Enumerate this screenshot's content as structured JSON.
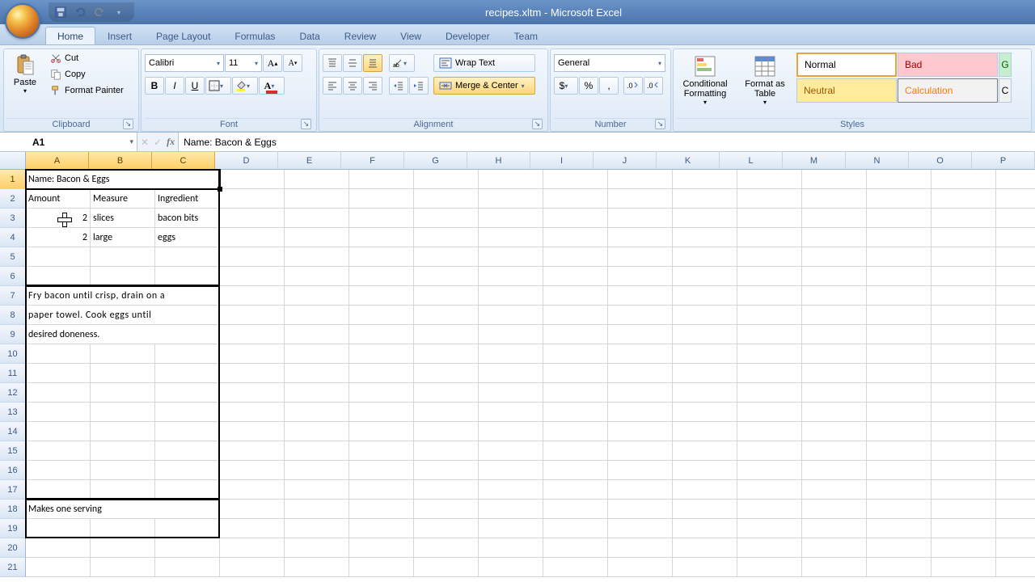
{
  "app": {
    "title": "recipes.xltm - Microsoft Excel"
  },
  "tabs": [
    "Home",
    "Insert",
    "Page Layout",
    "Formulas",
    "Data",
    "Review",
    "View",
    "Developer",
    "Team"
  ],
  "active_tab": "Home",
  "ribbon": {
    "clipboard": {
      "label": "Clipboard",
      "paste": "Paste",
      "cut": "Cut",
      "copy": "Copy",
      "format_painter": "Format Painter"
    },
    "font": {
      "label": "Font",
      "name": "Calibri",
      "size": "11"
    },
    "alignment": {
      "label": "Alignment",
      "wrap": "Wrap Text",
      "merge": "Merge & Center"
    },
    "number": {
      "label": "Number",
      "format": "General"
    },
    "styles": {
      "label": "Styles",
      "conditional": "Conditional Formatting",
      "format_table": "Format as Table",
      "cells": [
        "Normal",
        "Bad",
        "Neutral",
        "Calculation"
      ]
    }
  },
  "name_box": "A1",
  "formula": "Name: Bacon & Eggs",
  "columns": [
    {
      "l": "A",
      "w": 80
    },
    {
      "l": "B",
      "w": 80
    },
    {
      "l": "C",
      "w": 80
    },
    {
      "l": "D",
      "w": 80
    },
    {
      "l": "E",
      "w": 80
    },
    {
      "l": "F",
      "w": 80
    },
    {
      "l": "G",
      "w": 80
    },
    {
      "l": "H",
      "w": 80
    },
    {
      "l": "I",
      "w": 80
    },
    {
      "l": "J",
      "w": 80
    },
    {
      "l": "K",
      "w": 80
    },
    {
      "l": "L",
      "w": 80
    },
    {
      "l": "M",
      "w": 80
    },
    {
      "l": "N",
      "w": 80
    },
    {
      "l": "O",
      "w": 80
    },
    {
      "l": "P",
      "w": 80
    }
  ],
  "row_count": 21,
  "selected_columns": [
    "A",
    "B",
    "C"
  ],
  "selected_row": 1,
  "cells": {
    "A1": {
      "v": "Name: Bacon & Eggs",
      "span": 3
    },
    "A2": {
      "v": "Amount"
    },
    "B2": {
      "v": "Measure"
    },
    "C2": {
      "v": "Ingredient"
    },
    "A3": {
      "v": "2",
      "num": true
    },
    "B3": {
      "v": "slices"
    },
    "C3": {
      "v": "bacon bits"
    },
    "A4": {
      "v": "2",
      "num": true
    },
    "B4": {
      "v": "large"
    },
    "C4": {
      "v": "eggs"
    },
    "A7": {
      "v": "Fry bacon until crisp, drain on a",
      "span": 3,
      "just": true
    },
    "A8": {
      "v": "paper towel. Cook eggs until",
      "span": 3,
      "just": true
    },
    "A9": {
      "v": "desired doneness.",
      "span": 3
    },
    "A18": {
      "v": "Makes one serving",
      "span": 3
    }
  },
  "boxes": [
    {
      "r1": 1,
      "r2": 6,
      "c1": 0,
      "c2": 3
    },
    {
      "r1": 7,
      "r2": 17,
      "c1": 0,
      "c2": 3
    },
    {
      "r1": 18,
      "r2": 19,
      "c1": 0,
      "c2": 3
    }
  ],
  "chart_data": null
}
